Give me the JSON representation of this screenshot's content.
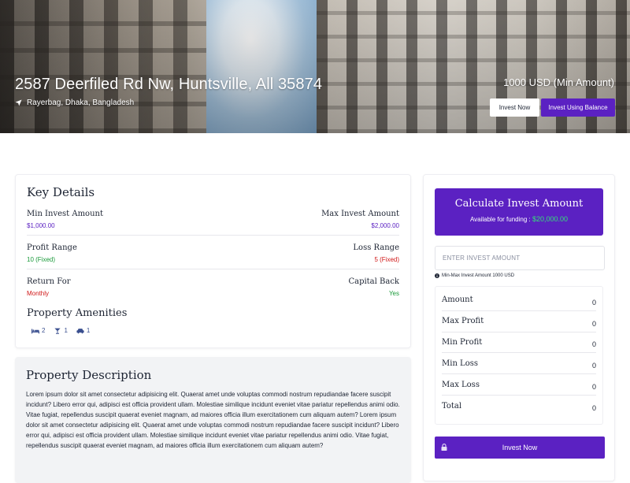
{
  "hero": {
    "title": "2587 Deerfiled Rd Nw, Huntsville, All 35874",
    "location": "Rayerbag, Dhaka, Bangladesh",
    "min_amount": "1000 USD (Min Amount)",
    "invest_now_label": "Invest Now",
    "invest_balance_label": "Invest Using Balance"
  },
  "key_details": {
    "title": "Key Details",
    "rows": [
      {
        "left_label": "Min Invest Amount",
        "left_value": "$1,000.00",
        "right_label": "Max Invest Amount",
        "right_value": "$2,000.00"
      },
      {
        "left_label": "Profit Range",
        "left_value": "10 (Fixed)",
        "right_label": "Loss Range",
        "right_value": "5 (Fixed)"
      },
      {
        "left_label": "Return For",
        "left_value": "Monthly",
        "right_label": "Capital Back",
        "right_value": "Yes"
      }
    ],
    "amenities_title": "Property Amenities",
    "amenities": [
      {
        "icon": "bed-icon",
        "value": "2"
      },
      {
        "icon": "cocktail-icon",
        "value": "1"
      },
      {
        "icon": "car-icon",
        "value": "1"
      }
    ]
  },
  "description": {
    "title": "Property Description",
    "text": "Lorem ipsum dolor sit amet consectetur adipisicing elit. Quaerat amet unde voluptas commodi nostrum repudiandae facere suscipit incidunt? Libero error qui, adipisci est officia provident ullam. Molestiae similique incidunt eveniet vitae pariatur repellendus animi odio. Vitae fugiat, repellendus suscipit quaerat eveniet magnam, ad maiores officia illum exercitationem cum aliquam autem? Lorem ipsum dolor sit amet consectetur adipisicing elit. Quaerat amet unde voluptas commodi nostrum repudiandae facere suscipit incidunt? Libero error qui, adipisci est officia provident ullam. Molestiae similique incidunt eveniet vitae pariatur repellendus animi odio. Vitae fugiat, repellendus suscipit quaerat eveniet magnam, ad maiores officia illum exercitationem cum aliquam autem?"
  },
  "calculator": {
    "title": "Calculate Invest Amount",
    "available_label": "Available for funding :",
    "available_amount": "$20,000.00",
    "input_placeholder": "ENTER INVEST AMOUNT",
    "hint": "Min-Max Invest Amount 1000 USD",
    "summary": [
      {
        "label": "Amount",
        "value": "0"
      },
      {
        "label": "Max Profit",
        "value": "0"
      },
      {
        "label": "Min Profit",
        "value": "0"
      },
      {
        "label": "Min Loss",
        "value": "0"
      },
      {
        "label": "Max Loss",
        "value": "0"
      },
      {
        "label": "Total",
        "value": "0"
      }
    ],
    "invest_button": "Invest Now"
  },
  "colors": {
    "accent": "#5b21c2",
    "success": "#1a9a3a",
    "danger": "#d01818"
  }
}
